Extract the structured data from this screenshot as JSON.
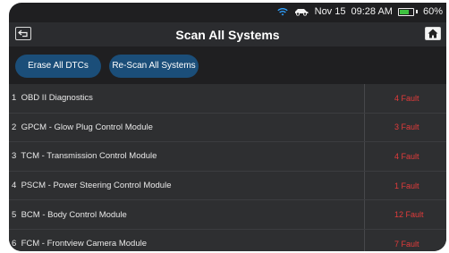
{
  "status": {
    "date": "Nov 15",
    "time": "09:28 AM",
    "battery_percent": 60,
    "battery_label": "60%"
  },
  "header": {
    "title": "Scan All Systems"
  },
  "toolbar": {
    "erase_label": "Erase All DTCs",
    "rescan_label": "Re-Scan All Systems"
  },
  "systems": [
    {
      "index": "1",
      "name": "OBD II Diagnostics",
      "fault": "4 Fault"
    },
    {
      "index": "2",
      "name": "GPCM - Glow Plug Control Module",
      "fault": "3 Fault"
    },
    {
      "index": "3",
      "name": "TCM - Transmission Control Module",
      "fault": "4 Fault"
    },
    {
      "index": "4",
      "name": "PSCM - Power Steering Control Module",
      "fault": "1 Fault"
    },
    {
      "index": "5",
      "name": "BCM - Body Control Module",
      "fault": "12 Fault"
    },
    {
      "index": "6",
      "name": "FCM - Frontview Camera Module",
      "fault": "7 Fault"
    }
  ],
  "colors": {
    "fault_text": "#e23b3b",
    "button_bg": "#1b4e79",
    "battery_fill": "#3ec140"
  }
}
